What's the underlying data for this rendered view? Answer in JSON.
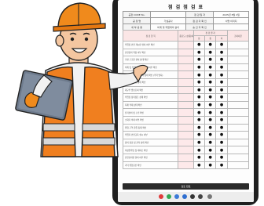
{
  "document": {
    "title": "점 검 점 검 표",
    "info_rows": [
      [
        "공정 CODE No.",
        "",
        "점 검 일 자",
        "2025년 8월 2일"
      ],
      [
        "공 정 명",
        "가설공사",
        "점 검 자 확 인",
        "서명 이미지"
      ],
      [
        "세 부 공 종",
        "비계 및 작업대의 설치",
        "승 인 자 확 인",
        ""
      ]
    ],
    "header_labels": {
      "item": "점 검 항 목",
      "importance": "중요도 (상/중/하)",
      "result_group": "점 검 결 과",
      "good": "양호",
      "poor": "불량",
      "na": "해당 없음",
      "note": "조치사항",
      "sub": [
        "상",
        "중",
        "하"
      ]
    },
    "mark": "●",
    "rows": [
      {
        "item": "작업장 안전 게시판 설치 여부 확인",
        "marks": [
          true,
          true,
          true
        ]
      },
      {
        "item": "안전장비 착용 여부 확인",
        "marks": [
          true,
          true,
          true
        ]
      },
      {
        "item": "가설 구조물 설치 상태 확인",
        "marks": [
          true,
          true,
          true
        ]
      },
      {
        "item": "비계 및 작업대 설치 적정성 여부 확인",
        "marks": [
          true,
          true,
          true
        ]
      },
      {
        "item": "안전난간 및 발판 설치 상태 확인 (추락 방지)",
        "marks": [
          true,
          true,
          true
        ]
      },
      {
        "item": "작업발판 고정 상태 확인",
        "marks": [
          true,
          true,
          true
        ]
      },
      {
        "item": "개구부 방호조치 확인",
        "marks": [
          true,
          true,
          true
        ]
      },
      {
        "item": "작업장 정리정돈 상태 확인",
        "marks": [
          true,
          true,
          true
        ]
      },
      {
        "item": "자재 적재 상태 확인",
        "marks": [
          true,
          true,
          true
        ]
      },
      {
        "item": "전기설비 및 누전 확인",
        "marks": [
          true,
          true,
          true
        ]
      },
      {
        "item": "소화기 비치 여부 확인",
        "marks": [
          true,
          true,
          true
        ]
      },
      {
        "item": "위험 구역 출입 통제 확인",
        "marks": [
          true,
          true,
          true
        ]
      },
      {
        "item": "작업자 안전교육 실시 여부",
        "marks": [
          true,
          true,
          true
        ]
      },
      {
        "item": "장비 점검 및 관리 상태 확인",
        "marks": [
          true,
          true,
          true
        ]
      },
      {
        "item": "비상연락망 및 대피로 확인",
        "marks": [
          true,
          true,
          true
        ]
      },
      {
        "item": "안전표지판 설치 여부 확인",
        "marks": [
          true,
          true,
          true
        ]
      },
      {
        "item": "기타 위험요인 확인",
        "marks": [
          true,
          true,
          true
        ]
      }
    ],
    "submit_label": "검토 완료"
  },
  "colors": {
    "helmet": "#f08a1c",
    "vest": "#f07f1f",
    "reflective": "#d8d8d8",
    "skin": "#f4c6a0",
    "clipboard": "#6d7a8c",
    "check_pink": "#fde9ea"
  },
  "nav_icons": [
    "red-app-icon",
    "green-app-icon",
    "blue-app-icon",
    "blue-app-icon",
    "dark-app-icon",
    "dark-app-icon",
    "grid-app-icon"
  ]
}
